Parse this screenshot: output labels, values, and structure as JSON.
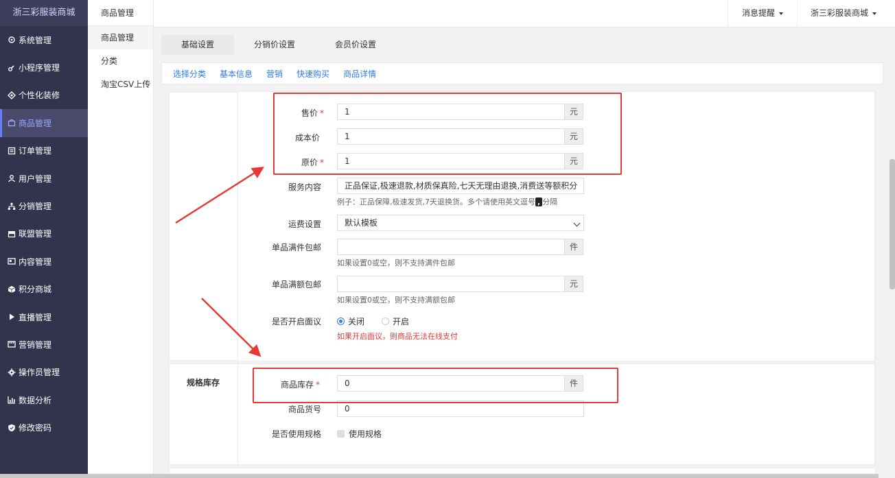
{
  "brand": "浙三彩服装商城",
  "menu": [
    {
      "label": "系统管理",
      "icon": "gear-icon"
    },
    {
      "label": "小程序管理",
      "icon": "link-icon"
    },
    {
      "label": "个性化装修",
      "icon": "diamond-icon"
    },
    {
      "label": "商品管理",
      "icon": "bag-icon",
      "active": true
    },
    {
      "label": "订单管理",
      "icon": "order-icon"
    },
    {
      "label": "用户管理",
      "icon": "user-icon"
    },
    {
      "label": "分销管理",
      "icon": "tree-icon"
    },
    {
      "label": "联盟管理",
      "icon": "store-icon"
    },
    {
      "label": "内容管理",
      "icon": "content-icon"
    },
    {
      "label": "积分商城",
      "icon": "cube-icon"
    },
    {
      "label": "直播管理",
      "icon": "play-icon"
    },
    {
      "label": "营销管理",
      "icon": "marketing-icon"
    },
    {
      "label": "操作员管理",
      "icon": "cog-icon"
    },
    {
      "label": "数据分析",
      "icon": "chart-icon"
    },
    {
      "label": "修改密码",
      "icon": "shield-icon"
    }
  ],
  "submenu": {
    "title": "商品管理",
    "items": [
      "商品管理",
      "分类",
      "淘宝CSV上传"
    ]
  },
  "topbar": {
    "notice": "消息提醒",
    "shop": "浙三彩服装商城"
  },
  "tabs": [
    "基础设置",
    "分销价设置",
    "会员价设置"
  ],
  "subtabs": [
    "选择分类",
    "基本信息",
    "营销",
    "快速购买",
    "商品详情"
  ],
  "form": {
    "price": {
      "label": "售价",
      "value": "1",
      "unit": "元"
    },
    "cost": {
      "label": "成本价",
      "value": "1",
      "unit": "元"
    },
    "original": {
      "label": "原价",
      "value": "1",
      "unit": "元"
    },
    "service": {
      "label": "服务内容",
      "value": "正品保证,极速退款,材质保真险,七天无理由退换,消费送等额积分",
      "hint_pre": "例子：正品保障,极速发货,7天退换货。多个请使用英文逗号",
      "hint_key": ",",
      "hint_post": "分隔"
    },
    "freight": {
      "label": "运费设置",
      "value": "默认模板"
    },
    "piece_free": {
      "label": "单品满件包邮",
      "value": "",
      "unit": "件",
      "hint": "如果设置0或空，则不支持满件包邮"
    },
    "amount_free": {
      "label": "单品满额包邮",
      "value": "",
      "unit": "元",
      "hint": "如果设置0或空，则不支持满额包邮"
    },
    "negotiable": {
      "label": "是否开启面议",
      "off": "关闭",
      "on": "开启",
      "hint": "如果开启面议，则商品无法在线支付"
    }
  },
  "spec": {
    "title": "规格库存",
    "stock": {
      "label": "商品库存",
      "value": "0",
      "unit": "件"
    },
    "sku": {
      "label": "商品货号",
      "value": "0"
    },
    "use_spec": {
      "label": "是否使用规格",
      "option": "使用规格"
    }
  },
  "colors": {
    "sidebar": "#33334d",
    "accent": "#2d7be5",
    "danger": "#e53935"
  }
}
